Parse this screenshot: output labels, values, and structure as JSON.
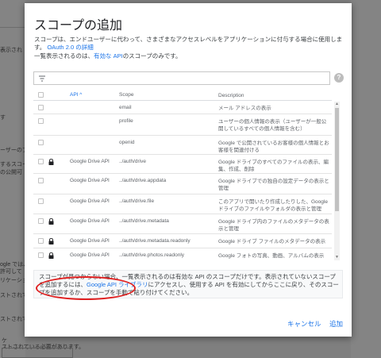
{
  "background": {
    "fragments": [
      "表示され",
      "す",
      "ーザーのプラ",
      "するスコー",
      "の公開可",
      "ogle では、",
      "許可して",
      "リケーショ",
      "ストされて",
      "ストされて"
    ],
    "bottom_label": "ケ",
    "bottom_text": "ストされている必要があります。"
  },
  "dialog": {
    "title": "スコープの追加",
    "description_prefix": "スコープは、エンドユーザーに代わって、さまざまなアクセスレベルをアプリケーションに付与する場合に使用します。",
    "description_link": "OAuth 2.0 の詳細",
    "description_line2_prefix": "一覧表示されるのは、",
    "description_line2_link": "有効な API",
    "description_line2_suffix": "のスコープのみです。",
    "filter": {
      "placeholder": ""
    },
    "help_icon": "?",
    "table": {
      "headers": {
        "api": "API",
        "sort_arrow": "^",
        "scope": "Scope",
        "description": "Description"
      },
      "rows": [
        {
          "locked": false,
          "api": "",
          "scope": "email",
          "description": "メール アドレスの表示"
        },
        {
          "locked": false,
          "api": "",
          "scope": "profile",
          "description": "ユーザーの個人情報の表示（ユーザーが一般公開しているすべての個人情報を含む）"
        },
        {
          "locked": false,
          "api": "",
          "scope": "openid",
          "description": "Google で公開されているお客様の個人情報とお客様を関連付ける"
        },
        {
          "locked": true,
          "api": "Google Drive API",
          "scope": "../auth/drive",
          "description": "Google ドライブのすべてのファイルの表示、編集、作成、削除"
        },
        {
          "locked": false,
          "api": "Google Drive API",
          "scope": "../auth/drive.appdata",
          "description": "Google ドライブでの独自の設定データの表示と管理"
        },
        {
          "locked": false,
          "api": "Google Drive API",
          "scope": "../auth/drive.file",
          "description": "このアプリで開いたり作成したりした、Google ドライブのファイルやフォルダの表示と管理"
        },
        {
          "locked": true,
          "api": "Google Drive API",
          "scope": "../auth/drive.metadata",
          "description": "Google ドライブ内のファイルのメタデータの表示と管理"
        },
        {
          "locked": true,
          "api": "Google Drive API",
          "scope": "../auth/drive.metadata.readonly",
          "description": "Google ドライブ ファイルのメタデータの表示"
        },
        {
          "locked": true,
          "api": "Google Drive API",
          "scope": "../auth/drive.photos.readonly",
          "description": "Google フォトの写真、動画、アルバムの表示"
        }
      ]
    },
    "note": {
      "line1": "スコープが見つからない場合、一覧表示されるのは有効な API のスコープだけです。表示されていないスコープを追加するには、",
      "link1": "Google API ライブラリ",
      "line2": "にアクセスし、使用する API を有効にしてからここに戻り、そのスコープを追加するか、スコープを手動で貼り付けてください。"
    },
    "buttons": {
      "cancel": "キャンセル",
      "add": "追加"
    }
  },
  "colors": {
    "link": "#1a73e8",
    "highlight": "#e02020"
  }
}
